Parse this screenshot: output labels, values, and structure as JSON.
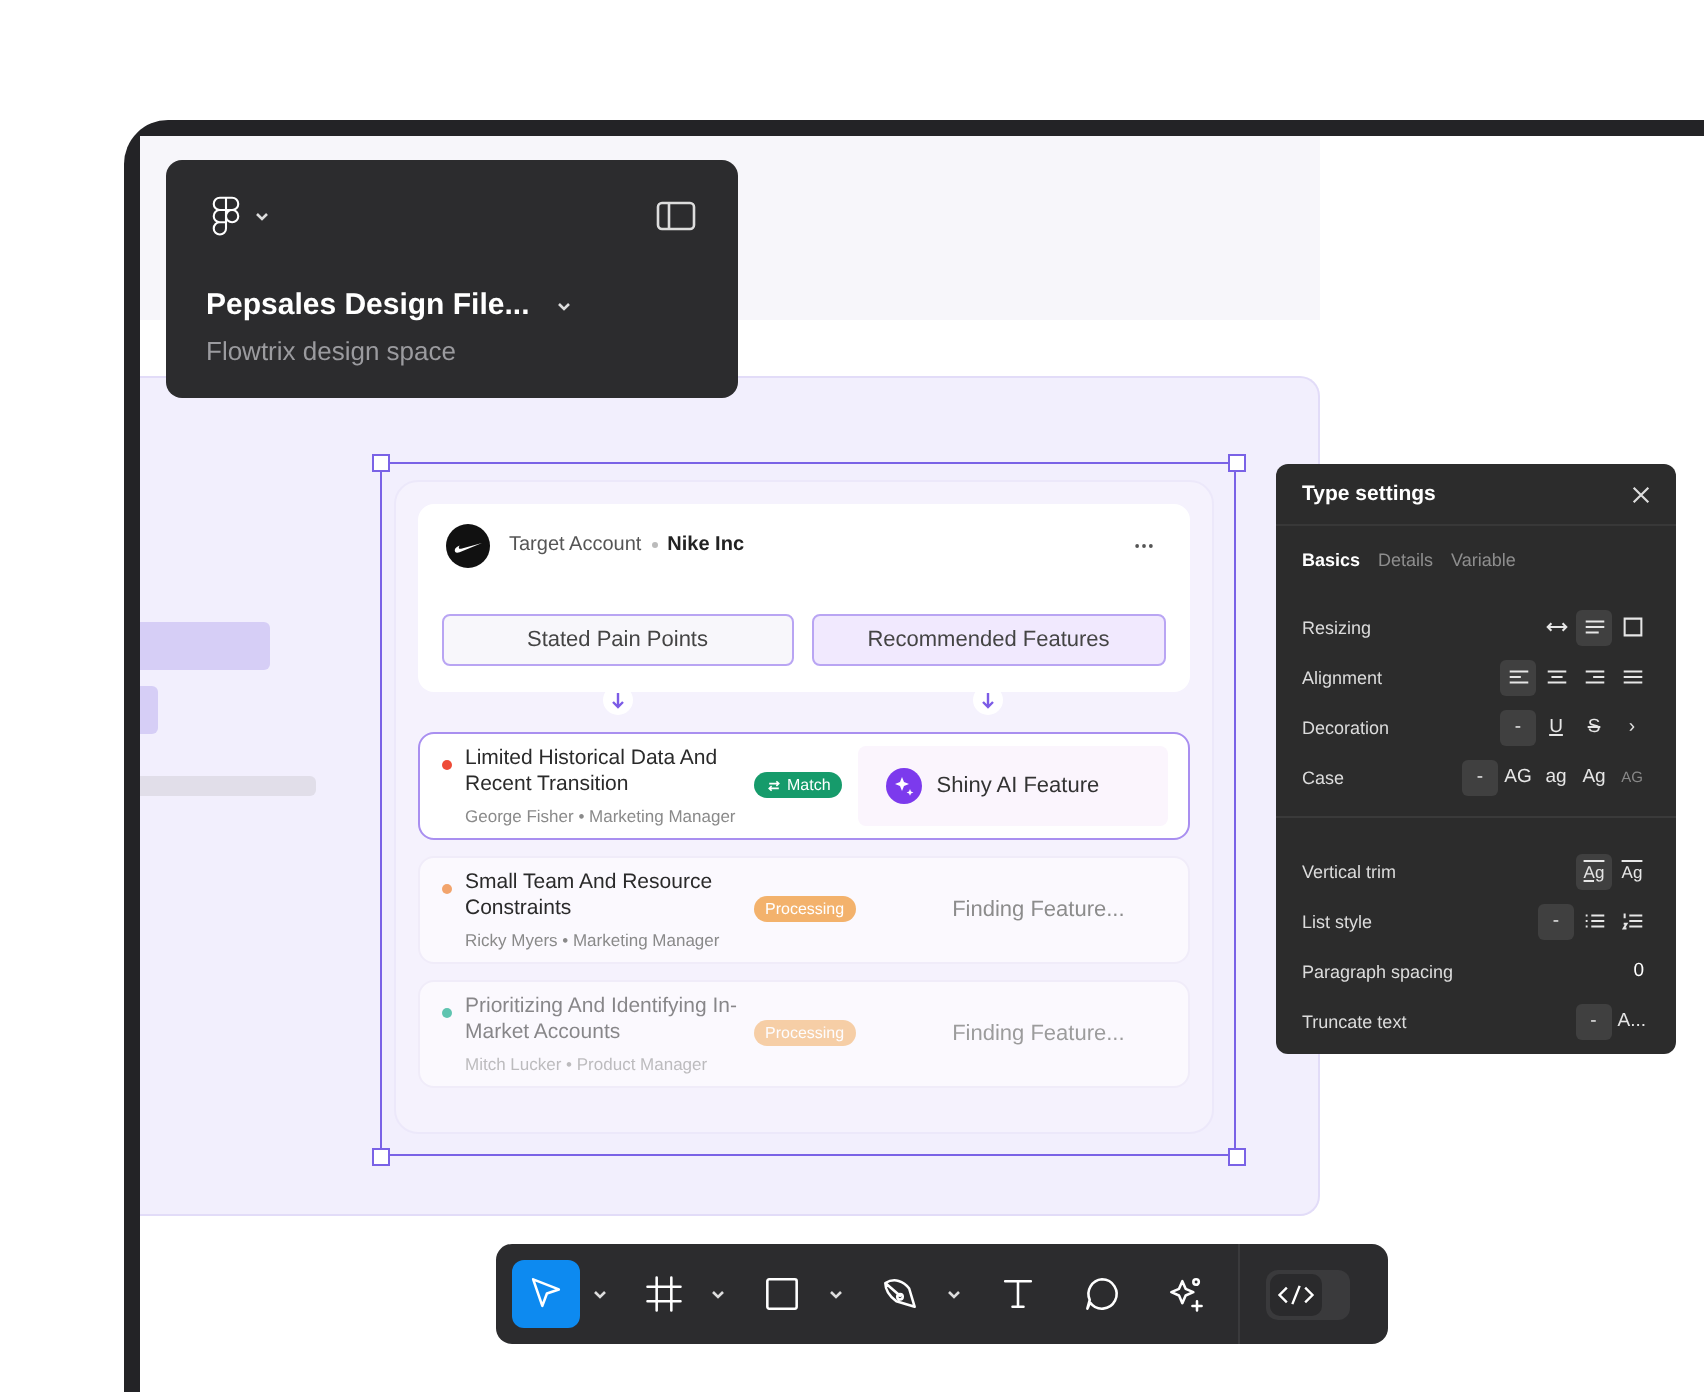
{
  "file_panel": {
    "title": "Pepsales Design File...",
    "subtitle": "Flowtrix design space"
  },
  "canvas": {
    "account": {
      "label": "Target Account",
      "name": "Nike Inc"
    },
    "columns": [
      {
        "label": "Stated Pain Points",
        "selected": false
      },
      {
        "label": "Recommended Features",
        "selected": true
      }
    ],
    "rows": [
      {
        "kind": "match",
        "title": "Limited Historical Data And Recent Transition",
        "meta": "George Fisher • Marketing Manager",
        "color": "#ee4b37",
        "status": "Match",
        "feature": "Shiny AI Feature",
        "selected": true,
        "faded": false
      },
      {
        "kind": "processing",
        "title": "Small Team And Resource Constraints",
        "meta": "Ricky Myers • Marketing Manager",
        "color": "#f2a46c",
        "status": "Processing",
        "feature": "Finding Feature...",
        "selected": false,
        "faded": false
      },
      {
        "kind": "processing",
        "title": "Prioritizing And Identifying In-Market Accounts",
        "meta": "Mitch Lucker • Product Manager",
        "color": "#5fc4b0",
        "status": "Processing",
        "feature": "Finding Feature...",
        "selected": false,
        "faded": true
      }
    ]
  },
  "type_settings": {
    "title": "Type settings",
    "tabs": [
      {
        "label": "Basics",
        "selected": true
      },
      {
        "label": "Details",
        "selected": false
      },
      {
        "label": "Variable",
        "selected": false
      }
    ],
    "groups": [
      {
        "rows": [
          {
            "label": "Resizing",
            "options": [
              {
                "kind": "hug",
                "selected": false
              },
              {
                "kind": "lines",
                "selected": true
              },
              {
                "kind": "square",
                "selected": false
              }
            ]
          },
          {
            "label": "Alignment",
            "options": [
              {
                "kind": "alignleft",
                "selected": true
              },
              {
                "kind": "aligncenter",
                "selected": false
              },
              {
                "kind": "alignright",
                "selected": false
              },
              {
                "kind": "justify",
                "selected": false
              }
            ]
          },
          {
            "label": "Decoration",
            "options": [
              {
                "kind": "text",
                "text": "-",
                "selected": true
              },
              {
                "kind": "underline",
                "text": "U",
                "selected": false
              },
              {
                "kind": "strike",
                "text": "S",
                "selected": false
              },
              {
                "kind": "text",
                "text": "›",
                "selected": false
              }
            ]
          },
          {
            "label": "Case",
            "options": [
              {
                "kind": "text",
                "text": "-",
                "selected": true
              },
              {
                "kind": "text",
                "text": "AG",
                "selected": false
              },
              {
                "kind": "text",
                "text": "ag",
                "selected": false
              },
              {
                "kind": "text",
                "text": "Ag",
                "selected": false
              },
              {
                "kind": "smallcaps",
                "text": "AG",
                "selected": false
              }
            ]
          }
        ]
      },
      {
        "rows": [
          {
            "label": "Vertical trim",
            "options": [
              {
                "kind": "trimcap",
                "text": "Ag",
                "selected": true
              },
              {
                "kind": "trimbase",
                "text": "Ag",
                "selected": false
              }
            ]
          },
          {
            "label": "List style",
            "options": [
              {
                "kind": "text",
                "text": "-",
                "selected": true
              },
              {
                "kind": "bulletlist",
                "selected": false
              },
              {
                "kind": "numberlist",
                "selected": false
              }
            ]
          },
          {
            "label": "Paragraph spacing",
            "value": "0"
          },
          {
            "label": "Truncate text",
            "options": [
              {
                "kind": "text",
                "text": "-",
                "selected": true
              },
              {
                "kind": "text",
                "text": "A...",
                "selected": false
              }
            ]
          }
        ]
      }
    ]
  },
  "toolbar": {
    "tools": [
      {
        "kind": "move",
        "selected": true,
        "menu": true
      },
      {
        "kind": "frame",
        "selected": false,
        "menu": true
      },
      {
        "kind": "rectangle",
        "selected": false,
        "menu": true
      },
      {
        "kind": "pen",
        "selected": false,
        "menu": true
      },
      {
        "kind": "text",
        "selected": false,
        "menu": false
      },
      {
        "kind": "comment",
        "selected": false,
        "menu": false
      },
      {
        "kind": "ai",
        "selected": false,
        "menu": false
      }
    ],
    "code_toggle": {
      "on": false
    }
  }
}
